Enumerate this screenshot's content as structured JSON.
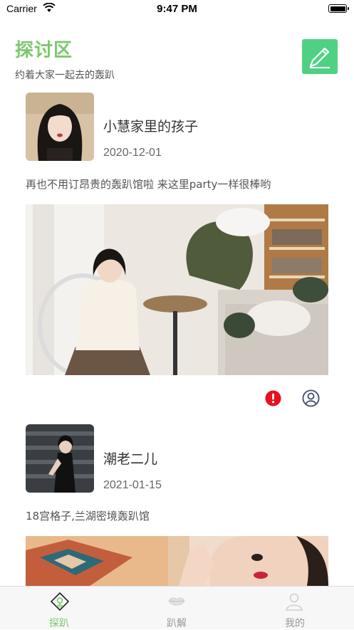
{
  "status_bar": {
    "carrier": "Carrier",
    "time": "9:47 PM"
  },
  "header": {
    "title": "探讨区",
    "subtitle": "约着大家一起去的轰趴"
  },
  "posts": [
    {
      "username": "小慧家里的孩子",
      "date": "2020-12-01",
      "text": "再也不用订昂贵的轰趴馆啦 来这里party一样很棒哟"
    },
    {
      "username": "潮老二儿",
      "date": "2021-01-15",
      "text": "18宫格子,兰湖密境轰趴馆"
    }
  ],
  "tabs": [
    {
      "label": "探趴",
      "icon": "explore-pin-icon",
      "active": true
    },
    {
      "label": "趴解",
      "icon": "lips-icon",
      "active": false
    },
    {
      "label": "我的",
      "icon": "person-icon",
      "active": false
    }
  ],
  "colors": {
    "accent": "#7bc86c",
    "compose_button": "#4fd184",
    "report": "#e8101d"
  }
}
